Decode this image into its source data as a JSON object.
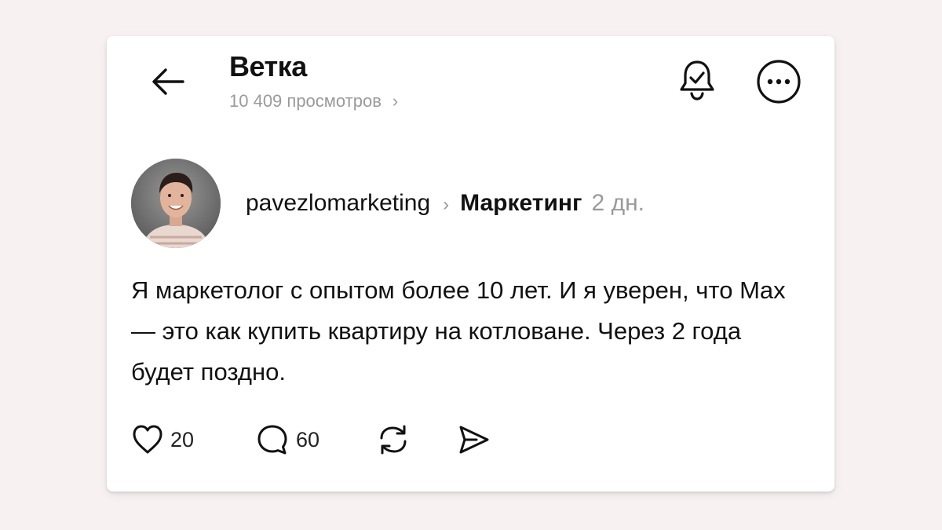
{
  "header": {
    "title": "Ветка",
    "views": "10 409 просмотров",
    "views_chevron": "›"
  },
  "post": {
    "author": "pavezlomarketing",
    "separator": "›",
    "topic": "Маркетинг",
    "time": "2 дн.",
    "text": "Я маркетолог с опытом более 10 лет. И я уверен, что Max — это как купить квартиру на котловане. Через 2 года будет поздно."
  },
  "actions": {
    "likes": "20",
    "comments": "60"
  },
  "icons": {
    "back": "arrow-left-icon",
    "bell": "bell-check-icon",
    "more": "more-horizontal-icon",
    "like": "heart-icon",
    "comment": "comment-bubble-icon",
    "repost": "repost-icon",
    "share": "send-icon"
  },
  "colors": {
    "background": "#f7f2f1",
    "card": "#ffffff",
    "text": "#111111",
    "muted": "#9a9a9a"
  }
}
